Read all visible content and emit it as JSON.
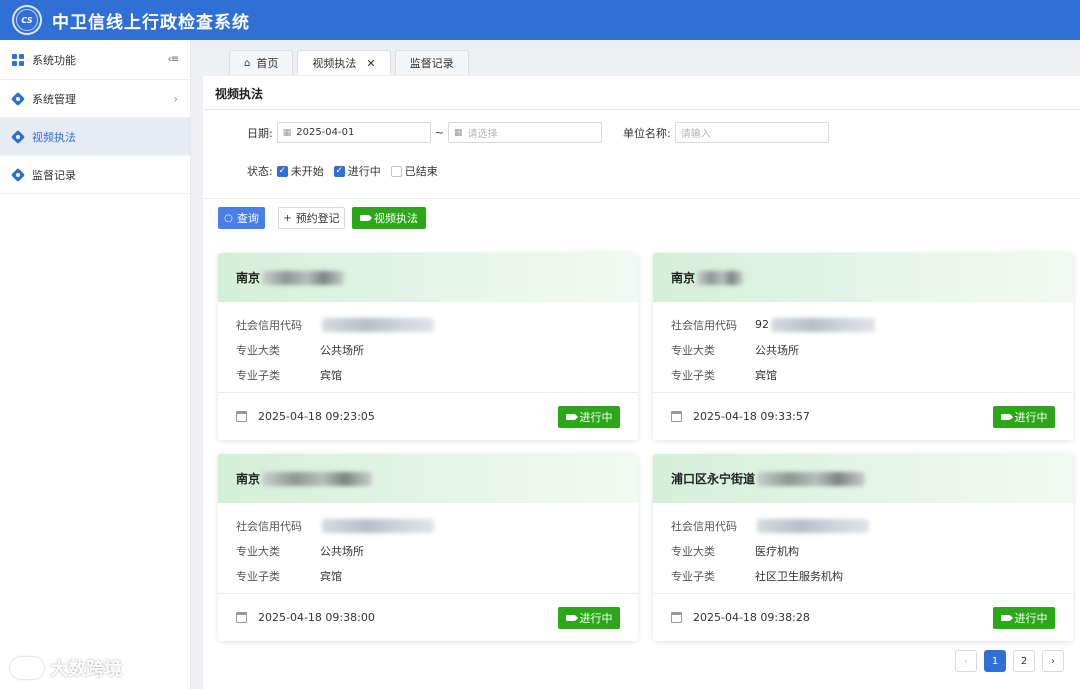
{
  "app": {
    "title": "中卫信线上行政检查系统",
    "logo_text": "CS"
  },
  "sidebar": {
    "header_label": "系统功能",
    "collapse_glyph": "‹≡",
    "items": [
      {
        "label": "系统管理",
        "chevron": "›"
      },
      {
        "label": "视频执法"
      },
      {
        "label": "监督记录"
      }
    ]
  },
  "tabs": [
    {
      "label": "首页",
      "home_glyph": "⌂"
    },
    {
      "label": "视频执法",
      "close_glyph": "✕"
    },
    {
      "label": "监督记录"
    }
  ],
  "page": {
    "title": "视频执法"
  },
  "filters": {
    "date_label": "日期:",
    "date_start": "2025-04-01",
    "date_separator": "~",
    "date_end_placeholder": "请选择",
    "unit_label": "单位名称:",
    "unit_placeholder": "请输入",
    "status_label": "状态:",
    "statuses": [
      {
        "label": "未开始",
        "checked": true
      },
      {
        "label": "进行中",
        "checked": true
      },
      {
        "label": "已结束",
        "checked": false
      }
    ]
  },
  "actions": {
    "query": "查询",
    "reserve": "预约登记",
    "video": "视频执法"
  },
  "field_labels": {
    "credit_code": "社会信用代码",
    "major": "专业大类",
    "minor": "专业子类"
  },
  "cards": [
    {
      "name": "南京",
      "credit_code": "",
      "major": "公共场所",
      "minor": "宾馆",
      "time": "2025-04-18 09:23:05",
      "status": "进行中"
    },
    {
      "name": "南京",
      "credit_code": "92",
      "major": "公共场所",
      "minor": "宾馆",
      "time": "2025-04-18 09:33:57",
      "status": "进行中"
    },
    {
      "name": "南京",
      "credit_code": "",
      "major": "公共场所",
      "minor": "宾馆",
      "time": "2025-04-18 09:38:00",
      "status": "进行中"
    },
    {
      "name": "浦口区永宁街道",
      "credit_code": "",
      "major": "医疗机构",
      "minor": "社区卫生服务机构",
      "time": "2025-04-18 09:38:28",
      "status": "进行中"
    }
  ],
  "pagination": {
    "prev": "‹",
    "pages": [
      "1",
      "2"
    ],
    "current": "1",
    "next": "›"
  },
  "watermark": {
    "text": "大数跨境"
  },
  "colors": {
    "primary": "#2f6fd6",
    "success": "#2ca71a"
  }
}
